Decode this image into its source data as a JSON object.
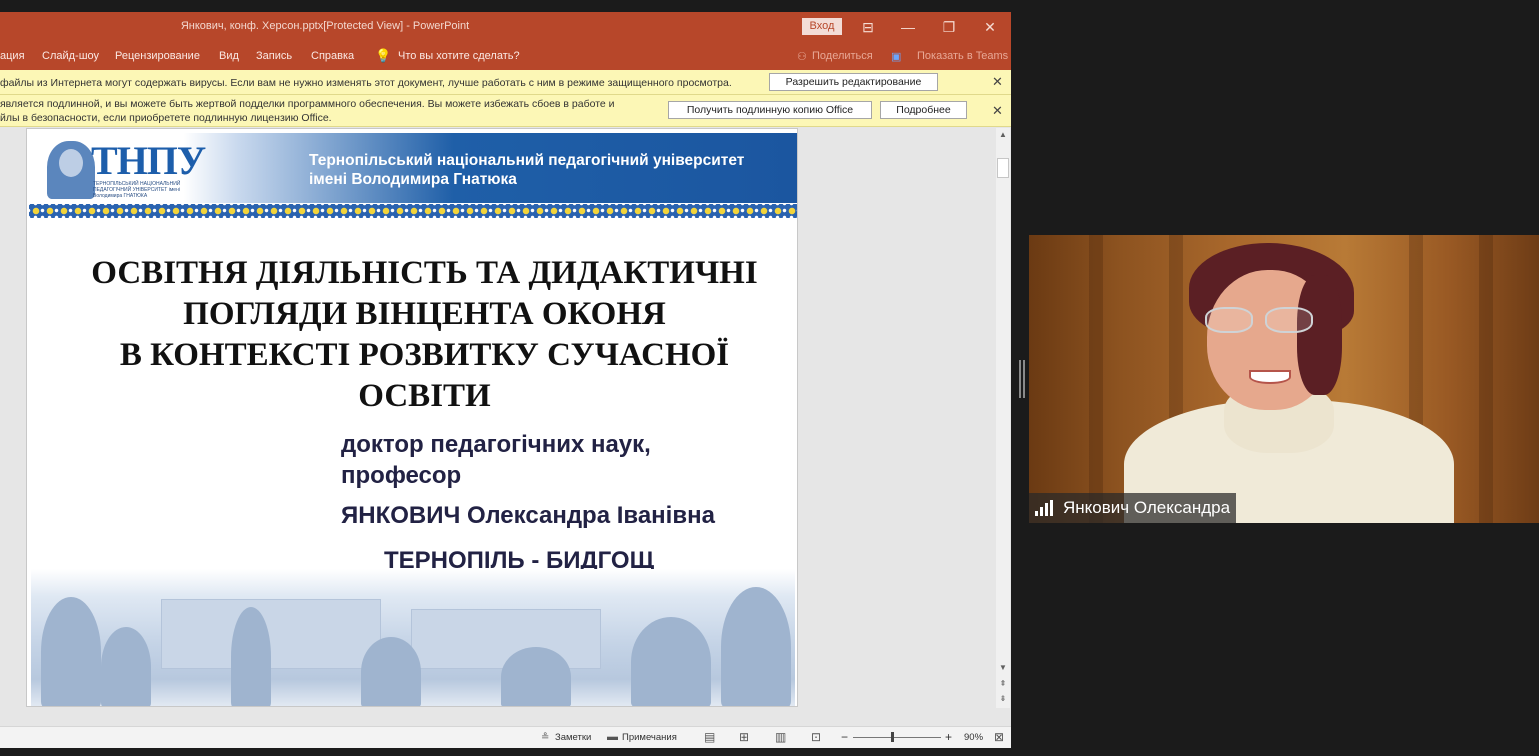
{
  "window": {
    "title": "Янкович, конф. Херсон.pptx[Protected View]  -  PowerPoint",
    "signin_label": "Вход",
    "controls": [
      "⊟",
      "—",
      "❐",
      "✕"
    ]
  },
  "ribbon": {
    "tabs": [
      "ация",
      "Слайд-шоу",
      "Рецензирование",
      "Вид",
      "Запись",
      "Справка"
    ],
    "tell_me": "Что вы хотите сделать?",
    "share": "Поделиться",
    "teams": "Показать в Teams"
  },
  "protected_bar": {
    "message": "файлы из Интернета могут содержать вирусы. Если вам не нужно изменять этот документ, лучше работать с ним в режиме защищенного просмотра.",
    "enable_button": "Разрешить редактирование"
  },
  "license_bar": {
    "line1": "является подлинной, и вы можете быть жертвой подделки программного обеспечения. Вы можете избежать сбоев в работе и",
    "line2": "йлы в безопасности, если приобретете подлинную лицензию Office.",
    "genuine_button": "Получить подлинную копию Office",
    "more_button": "Подробнее"
  },
  "slide": {
    "logo": "ТНПУ",
    "logo_caption": "ТЕРНОПІЛЬСЬКИЙ НАЦІОНАЛЬНИЙ ПЕДАГОГІЧНИЙ УНІВЕРСИТЕТ імені Володимира ГНАТЮКА",
    "university_line1": "Тернопільський національний педагогічний університет",
    "university_line2": "імені Володимира Гнатюка",
    "title_line1": "ОСВІТНЯ ДІЯЛЬНІСТЬ ТА ДИДАКТИЧНІ",
    "title_line2": "ПОГЛЯДИ ВІНЦЕНТА ОКОНЯ",
    "title_line3": "В КОНТЕКСТІ РОЗВИТКУ СУЧАСНОЇ",
    "title_line4": "ОСВІТИ",
    "degree_line1": "доктор педагогічних наук,",
    "degree_line2": "професор",
    "author": "ЯНКОВИЧ Олександра Іванівна",
    "city": "ТЕРНОПІЛЬ - БИДГОЩ"
  },
  "statusbar": {
    "notes": "Заметки",
    "comments": "Примечания",
    "zoom_percent": "90%",
    "zoom_minus": "−",
    "zoom_plus": "+"
  },
  "video": {
    "participant_name": "Янкович Олександра"
  },
  "colors": {
    "powerpoint_accent": "#b7472a",
    "message_bar": "#fcf7b6",
    "banner_blue": "#1f5fa8"
  }
}
